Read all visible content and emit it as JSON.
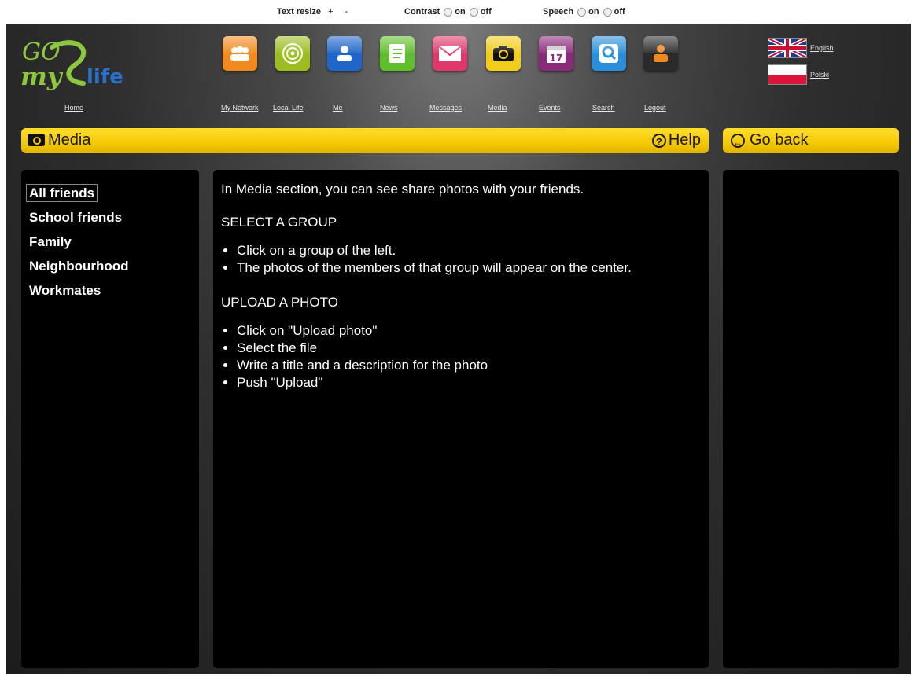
{
  "topbar": {
    "text_resize_label": "Text resize",
    "text_resize_plus": "+",
    "text_resize_minus": "-",
    "contrast_label": "Contrast",
    "contrast_on": "on",
    "contrast_off": "off",
    "speech_label": "Speech",
    "speech_on": "on",
    "speech_off": "off"
  },
  "logo": {
    "home_label": "Home"
  },
  "nav": [
    {
      "label": "My Network",
      "icon": "people-icon",
      "color": "#f08a1e"
    },
    {
      "label": "Local Life",
      "icon": "target-icon",
      "color": "#9bbd1f"
    },
    {
      "label": "Me",
      "icon": "person-icon",
      "color": "#1f66c8"
    },
    {
      "label": "News",
      "icon": "document-icon",
      "color": "#5fbf2a"
    },
    {
      "label": "Messages",
      "icon": "envelope-icon",
      "color": "#e0386a"
    },
    {
      "label": "Media",
      "icon": "camera-icon",
      "color": "#f2cc1a"
    },
    {
      "label": "Events",
      "icon": "calendar-icon",
      "color": "#8a2a7a"
    },
    {
      "label": "Search",
      "icon": "magnifier-icon",
      "color": "#2a8fd8"
    },
    {
      "label": "Logout",
      "icon": "logout-icon",
      "color": "#2a2a2a"
    }
  ],
  "languages": [
    {
      "label": "English",
      "icon": "uk-flag-icon"
    },
    {
      "label": "Polski",
      "icon": "poland-flag-icon"
    }
  ],
  "section": {
    "title": "Media",
    "help_label": "Help",
    "go_back_label": "Go back"
  },
  "groups": [
    "All friends",
    "School friends",
    "Family",
    "Neighbourhood",
    "Workmates"
  ],
  "help": {
    "intro": "In Media section, you can see share photos with your friends.",
    "select_heading": "SELECT A GROUP",
    "select_steps": [
      "Click on a group of the left.",
      "The photos of the members of that group will appear on the center."
    ],
    "upload_heading": "UPLOAD A PHOTO",
    "upload_steps": [
      "Click on \"Upload photo\"",
      "Select the file",
      "Write a title and a description for the photo",
      "Push \"Upload\""
    ]
  }
}
